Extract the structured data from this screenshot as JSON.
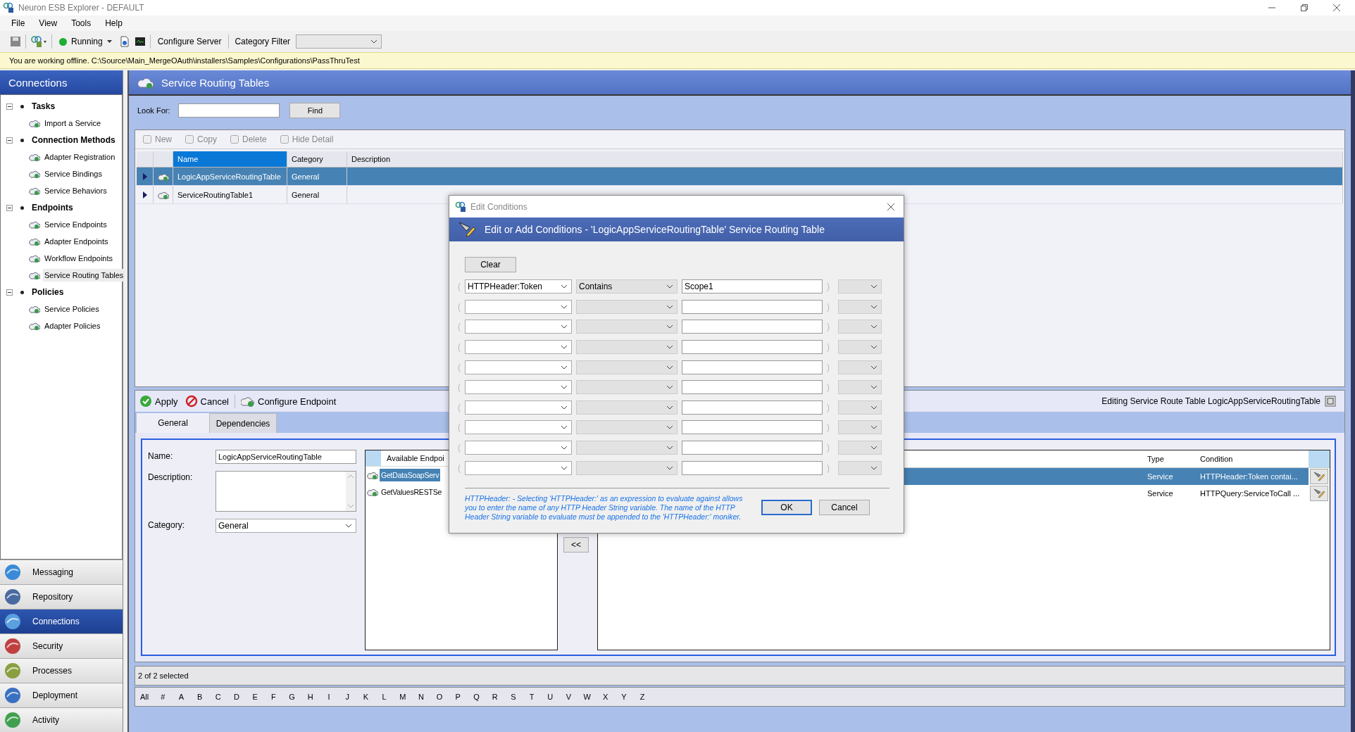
{
  "window": {
    "title": "Neuron ESB Explorer - DEFAULT"
  },
  "menu": [
    "File",
    "View",
    "Tools",
    "Help"
  ],
  "toolbar": {
    "status": "Running",
    "configure": "Configure Server",
    "category_label": "Category Filter"
  },
  "offline_message": "You are working offline. C:\\Source\\Main_MergeOAuth\\installers\\Samples\\Configurations\\PassThruTest",
  "sidebar": {
    "title": "Connections",
    "groups": [
      {
        "label": "Tasks",
        "expanded": true,
        "children": [
          {
            "label": "Import a Service",
            "selected": false
          }
        ]
      },
      {
        "label": "Connection Methods",
        "expanded": true,
        "children": [
          {
            "label": "Adapter Registration",
            "selected": false
          },
          {
            "label": "Service Bindings",
            "selected": false
          },
          {
            "label": "Service Behaviors",
            "selected": false
          }
        ]
      },
      {
        "label": "Endpoints",
        "expanded": true,
        "children": [
          {
            "label": "Service Endpoints",
            "selected": false
          },
          {
            "label": "Adapter Endpoints",
            "selected": false
          },
          {
            "label": "Workflow Endpoints",
            "selected": false
          },
          {
            "label": "Service Routing Tables",
            "selected": true
          }
        ]
      },
      {
        "label": "Policies",
        "expanded": true,
        "children": [
          {
            "label": "Service Policies",
            "selected": false
          },
          {
            "label": "Adapter Policies",
            "selected": false
          }
        ]
      }
    ]
  },
  "nav": [
    {
      "label": "Messaging",
      "selected": false
    },
    {
      "label": "Repository",
      "selected": false
    },
    {
      "label": "Connections",
      "selected": true
    },
    {
      "label": "Security",
      "selected": false
    },
    {
      "label": "Processes",
      "selected": false
    },
    {
      "label": "Deployment",
      "selected": false
    },
    {
      "label": "Activity",
      "selected": false
    }
  ],
  "panel": {
    "title": "Service Routing Tables",
    "look_for_label": "Look For:",
    "find": "Find"
  },
  "grid_toolbar": [
    {
      "label": "New",
      "disabled": true
    },
    {
      "label": "Copy",
      "disabled": true
    },
    {
      "label": "Delete",
      "disabled": true
    },
    {
      "label": "Hide Detail",
      "disabled": true
    }
  ],
  "grid": {
    "columns": [
      "Name",
      "Category",
      "Description"
    ],
    "rows": [
      {
        "name": "LogicAppServiceRoutingTable",
        "category": "General",
        "selected": true
      },
      {
        "name": "ServiceRoutingTable1",
        "category": "General",
        "selected": false
      }
    ]
  },
  "detail": {
    "actions": [
      "Apply",
      "Cancel",
      "Configure Endpoint"
    ],
    "editing": "Editing Service Route Table LogicAppServiceRoutingTable",
    "tabs": [
      {
        "label": "General",
        "selected": true
      },
      {
        "label": "Dependencies",
        "selected": false
      }
    ],
    "name_label": "Name:",
    "name": "LogicAppServiceRoutingTable",
    "description_label": "Description:",
    "category_label": "Category:",
    "category": "General",
    "available": {
      "header": "Available Endpoi",
      "items": [
        {
          "label": "GetDataSoapServ",
          "selected": true
        },
        {
          "label": "GetValuesRESTSe",
          "selected": false
        }
      ]
    },
    "move_left": "<<",
    "routes": {
      "columns": [
        "Type",
        "Condition"
      ],
      "rows": [
        {
          "type": "Service",
          "condition": "HTTPHeader:Token contai...",
          "selected": true
        },
        {
          "type": "Service",
          "condition": "HTTPQuery:ServiceToCall ...",
          "selected": false
        }
      ]
    }
  },
  "status": "2 of 2 selected",
  "letters": [
    "All",
    "#",
    "A",
    "B",
    "C",
    "D",
    "E",
    "F",
    "G",
    "H",
    "I",
    "J",
    "K",
    "L",
    "M",
    "N",
    "O",
    "P",
    "Q",
    "R",
    "S",
    "T",
    "U",
    "V",
    "W",
    "X",
    "Y",
    "Z"
  ],
  "dialog": {
    "title": "Edit Conditions",
    "header": "Edit or Add Conditions - 'LogicAppServiceRoutingTable' Service Routing Table",
    "clear": "Clear",
    "rows": [
      {
        "open": "(",
        "expression": "HTTPHeader:Token",
        "operator": "Contains",
        "value": "Scope1",
        "close": ")"
      },
      {
        "open": "(",
        "close": ")"
      },
      {
        "open": "(",
        "close": ")"
      },
      {
        "open": "(",
        "close": ")"
      },
      {
        "open": "(",
        "close": ")"
      },
      {
        "open": "(",
        "close": ")"
      },
      {
        "open": "(",
        "close": ")"
      },
      {
        "open": "(",
        "close": ")"
      },
      {
        "open": "(",
        "close": ")"
      },
      {
        "open": "(",
        "close": ")"
      }
    ],
    "hint": "HTTPHeader: - Selecting 'HTTPHeader:' as an expression to evaluate against allows you to enter the name of any HTTP Header String variable. The name of the HTTP Header String variable to evaluate must be appended to the 'HTTPHeader:' moniker.",
    "ok": "OK",
    "cancel": "Cancel"
  }
}
